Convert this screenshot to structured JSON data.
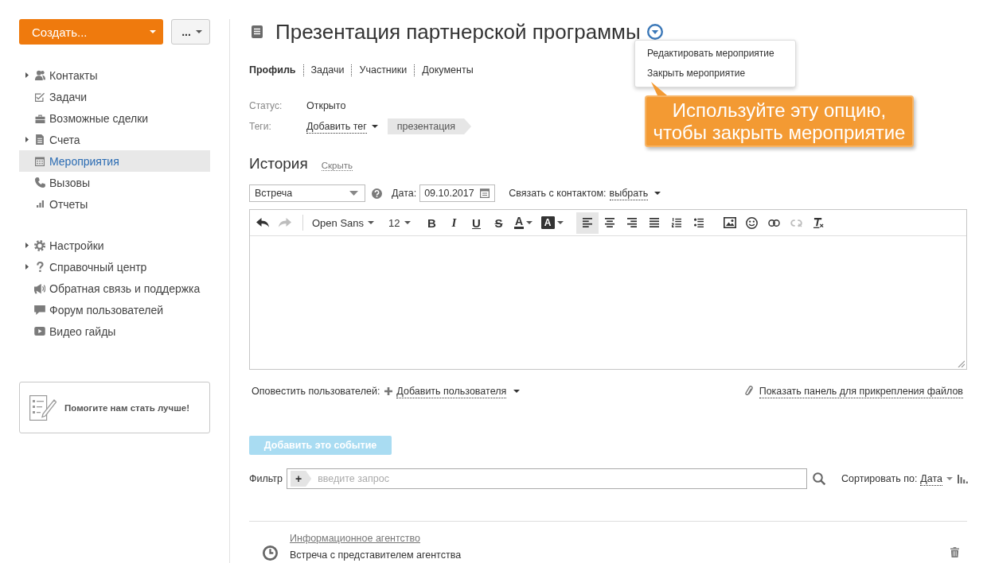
{
  "sidebar": {
    "create_button": "Создать...",
    "more_button": "...",
    "nav_items": [
      {
        "label": "Контакты",
        "expandable": true,
        "selected": false
      },
      {
        "label": "Задачи",
        "expandable": false,
        "selected": false
      },
      {
        "label": "Возможные сделки",
        "expandable": false,
        "selected": false
      },
      {
        "label": "Счета",
        "expandable": true,
        "selected": false
      },
      {
        "label": "Мероприятия",
        "expandable": false,
        "selected": true
      },
      {
        "label": "Вызовы",
        "expandable": false,
        "selected": false
      },
      {
        "label": "Отчеты",
        "expandable": false,
        "selected": false
      }
    ],
    "help_items": [
      {
        "label": "Настройки",
        "expandable": true,
        "selected": false
      },
      {
        "label": "Справочный центр",
        "expandable": true,
        "selected": false
      },
      {
        "label": "Обратная связь и поддержка",
        "expandable": false,
        "selected": false
      },
      {
        "label": "Форум пользователей",
        "expandable": false,
        "selected": false
      },
      {
        "label": "Видео гайды",
        "expandable": false,
        "selected": false
      }
    ],
    "feedback_card": "Помогите нам стать лучше!"
  },
  "header": {
    "title": "Презентация партнерской программы",
    "menu_items": [
      "Редактировать мероприятие",
      "Закрыть мероприятие"
    ]
  },
  "callout": {
    "text": "Используйте эту опцию, чтобы закрыть мероприятие"
  },
  "tabs": [
    {
      "label": "Профиль",
      "selected": true
    },
    {
      "label": "Задачи",
      "selected": false
    },
    {
      "label": "Участники",
      "selected": false
    },
    {
      "label": "Документы",
      "selected": false
    }
  ],
  "details": {
    "status_label": "Статус:",
    "status_value": "Открыто",
    "tags_label": "Теги:",
    "add_tag_link": "Добавить тег",
    "tags": [
      "презентация"
    ]
  },
  "history": {
    "title": "История",
    "hide_link": "Скрыть",
    "type_select": "Встреча",
    "date_label": "Дата:",
    "date_value": "09.10.2017",
    "contact_label": "Связать с контактом:",
    "contact_link": "выбрать"
  },
  "editor": {
    "history_buttons": [
      {
        "disabled": false
      },
      {
        "disabled": true
      }
    ],
    "font": "Open Sans",
    "size": "12",
    "format_buttons": [
      "B",
      "I",
      "U",
      "S"
    ],
    "color_buttons": [
      "A",
      "A"
    ],
    "align_buttons": [
      {
        "selected": true
      },
      {
        "selected": false
      },
      {
        "selected": false
      },
      {
        "selected": false
      }
    ],
    "insert_buttons": [
      {
        "disabled": false
      },
      {
        "disabled": false
      },
      {
        "disabled": false
      },
      {
        "disabled": true
      },
      {
        "disabled": false
      }
    ]
  },
  "notify": {
    "label": "Оповестить пользователей:",
    "add_user_link": "Добавить пользователя",
    "attach_link": "Показать панель для прикрепления файлов"
  },
  "add_event_button": {
    "label": "Добавить это событие",
    "disabled": true
  },
  "filter": {
    "label": "Фильтр",
    "add_button": "+",
    "placeholder": "введите запрос",
    "sort_label": "Сортировать по:",
    "sort_value": "Дата"
  },
  "events": [
    {
      "title": "Информационное агентство",
      "description": "Встреча с представителем агентства"
    }
  ]
}
